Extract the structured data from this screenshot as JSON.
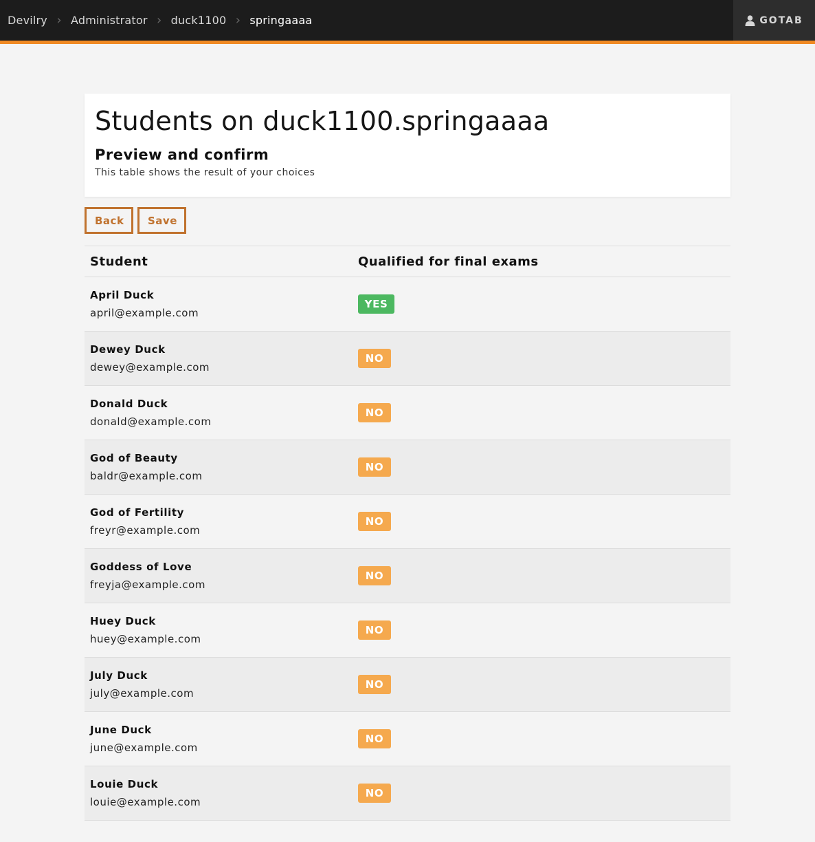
{
  "breadcrumb": [
    {
      "label": "Devilry"
    },
    {
      "label": "Administrator"
    },
    {
      "label": "duck1100"
    },
    {
      "label": "springaaaa"
    }
  ],
  "user": {
    "label": "GOTAB",
    "icon": "user-icon"
  },
  "header": {
    "title": "Students on duck1100.springaaaa",
    "subtitle": "Preview and confirm",
    "description": "This table shows the result of your choices"
  },
  "actions": {
    "back_label": "Back",
    "save_label": "Save"
  },
  "table": {
    "columns": [
      "Student",
      "Qualified for final exams"
    ],
    "rows": [
      {
        "name": "April Duck",
        "email": "april@example.com",
        "qualified": "YES"
      },
      {
        "name": "Dewey Duck",
        "email": "dewey@example.com",
        "qualified": "NO"
      },
      {
        "name": "Donald Duck",
        "email": "donald@example.com",
        "qualified": "NO"
      },
      {
        "name": "God of Beauty",
        "email": "baldr@example.com",
        "qualified": "NO"
      },
      {
        "name": "God of Fertility",
        "email": "freyr@example.com",
        "qualified": "NO"
      },
      {
        "name": "Goddess of Love",
        "email": "freyja@example.com",
        "qualified": "NO"
      },
      {
        "name": "Huey Duck",
        "email": "huey@example.com",
        "qualified": "NO"
      },
      {
        "name": "July Duck",
        "email": "july@example.com",
        "qualified": "NO"
      },
      {
        "name": "June Duck",
        "email": "june@example.com",
        "qualified": "NO"
      },
      {
        "name": "Louie Duck",
        "email": "louie@example.com",
        "qualified": "NO"
      }
    ]
  },
  "colors": {
    "accent": "#f08a24",
    "button": "#c0722e",
    "yes": "#4cb860",
    "no": "#f5a94e",
    "topbar": "#1c1c1c"
  }
}
